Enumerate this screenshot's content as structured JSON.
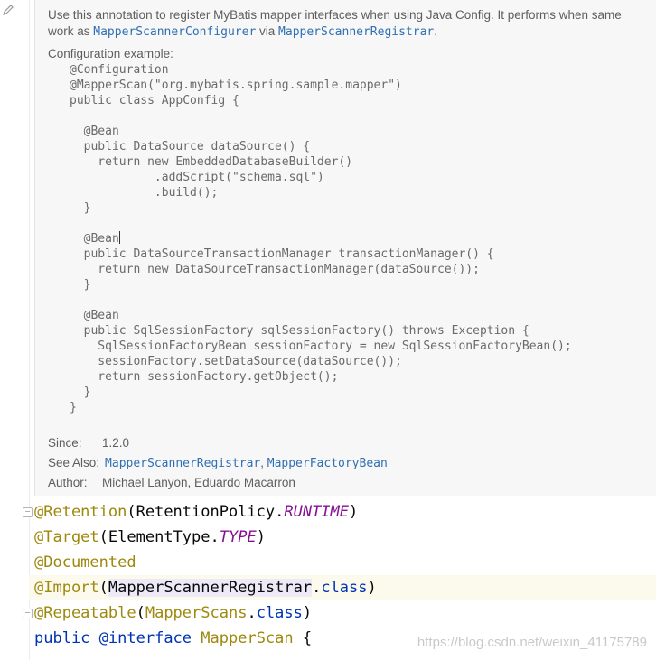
{
  "doc": {
    "description_part1": "Use this annotation to register MyBatis mapper interfaces when using Java Config. It performs when same work as ",
    "link1": "MapperScannerConfigurer",
    "description_via": " via ",
    "link2": "MapperScannerRegistrar",
    "description_end": ".",
    "config_label": "Configuration example:",
    "code_example": "@Configuration\n@MapperScan(\"org.mybatis.spring.sample.mapper\")\npublic class AppConfig {\n\n  @Bean\n  public DataSource dataSource() {\n    return new EmbeddedDatabaseBuilder()\n            .addScript(\"schema.sql\")\n            .build();\n  }\n\n  @Bean",
    "code_example_rest": "\n  public DataSourceTransactionManager transactionManager() {\n    return new DataSourceTransactionManager(dataSource());\n  }\n\n  @Bean\n  public SqlSessionFactory sqlSessionFactory() throws Exception {\n    SqlSessionFactoryBean sessionFactory = new SqlSessionFactoryBean();\n    sessionFactory.setDataSource(dataSource());\n    return sessionFactory.getObject();\n  }\n}",
    "since_label": "Since:",
    "since_value": "1.2.0",
    "see_also_label": "See Also:",
    "see_also_link1": "MapperScannerRegistrar",
    "see_also_sep": ", ",
    "see_also_link2": "MapperFactoryBean",
    "author_label": "Author:",
    "author_value": "Michael Lanyon, Eduardo Macarron"
  },
  "source": {
    "line1": {
      "ann": "@Retention",
      "open": "(",
      "type": "RetentionPolicy.",
      "const": "RUNTIME",
      "close": ")"
    },
    "line2": {
      "ann": "@Target",
      "open": "(",
      "type": "ElementType.",
      "const": "TYPE",
      "close": ")"
    },
    "line3": {
      "ann": "@Documented"
    },
    "line4": {
      "ann": "@Import",
      "open": "(",
      "type": "MapperScannerRegistrar",
      "dot": ".",
      "kw": "class",
      "close": ")"
    },
    "line5": {
      "ann": "@Repeatable",
      "open": "(",
      "type": "MapperScans",
      "dot": ".",
      "kw": "class",
      "close": ")"
    },
    "line6": {
      "kw1": "public",
      "kw2": "@interface",
      "name": "MapperScan",
      "brace": "{"
    }
  },
  "watermark": "https://blog.csdn.net/weixin_41175789",
  "icons": {
    "edit": "pencil-icon",
    "fold": "fold-icon"
  },
  "colors": {
    "annotation": "#9e880d",
    "keyword": "#0033b3",
    "constant": "#871094",
    "link": "#2f6fb3",
    "doc_background": "#f7f7f7",
    "line_highlight": "#fcfaed"
  }
}
